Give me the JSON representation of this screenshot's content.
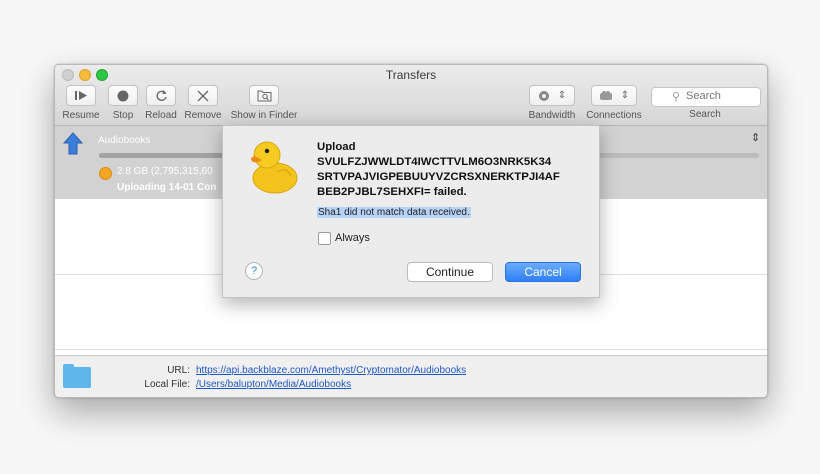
{
  "window": {
    "title": "Transfers"
  },
  "toolbar": {
    "resume": "Resume",
    "stop": "Stop",
    "reload": "Reload",
    "remove": "Remove",
    "show_in_finder": "Show in Finder",
    "bandwidth": "Bandwidth",
    "connections": "Connections",
    "search_placeholder": "Search",
    "search_label": "Search"
  },
  "transfer": {
    "name": "Audiobooks",
    "size_text": "2.8 GB (2,795,315,60",
    "status_text": "Uploading 14-01 Con",
    "progress": 0.42
  },
  "details": {
    "url_label": "URL:",
    "url": "https://api.backblaze.com/Amethyst/Cryptomator/Audiobooks",
    "local_label": "Local File:",
    "local_file": "/Users/balupton/Media/Audiobooks"
  },
  "dialog": {
    "title": "Upload SVULFZJWWLDT4IWCTTVLM6O3NRK5K34 SRTVPAJVIGPEBUUYVZCRSXNERKTPJI4AF BEB2PJBL7SEHXFI= failed.",
    "message": "Sha1 did not match data received.",
    "always_label": "Always",
    "help_label": "?",
    "continue_label": "Continue",
    "cancel_label": "Cancel"
  }
}
